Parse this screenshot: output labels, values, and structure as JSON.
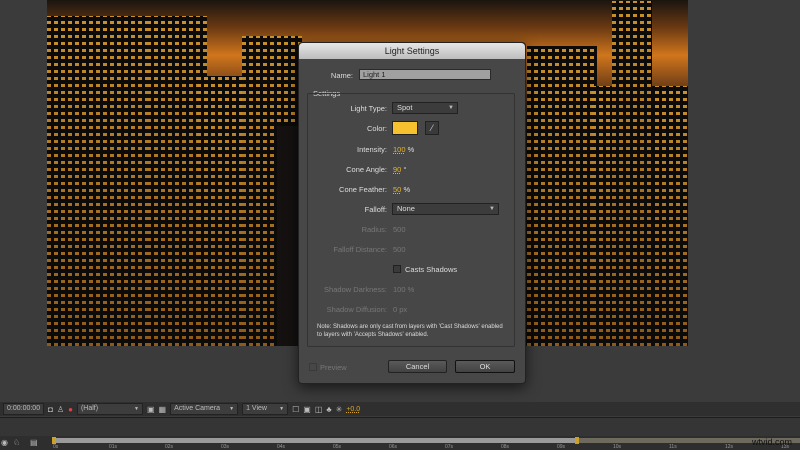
{
  "dialog": {
    "title": "Light Settings",
    "name_label": "Name:",
    "name_value": "Light 1",
    "group_label": "Settings",
    "light_type_label": "Light Type:",
    "light_type_value": "Spot",
    "color_label": "Color:",
    "color_value": "#f7c02e",
    "intensity_label": "Intensity:",
    "intensity_value": "100",
    "intensity_unit": "%",
    "cone_angle_label": "Cone Angle:",
    "cone_angle_value": "90",
    "cone_angle_unit": "°",
    "cone_feather_label": "Cone Feather:",
    "cone_feather_value": "50",
    "cone_feather_unit": "%",
    "falloff_label": "Falloff:",
    "falloff_value": "None",
    "radius_label": "Radius:",
    "radius_value": "500",
    "falloff_distance_label": "Falloff Distance:",
    "falloff_distance_value": "500",
    "casts_shadows_label": "Casts Shadows",
    "shadow_darkness_label": "Shadow Darkness:",
    "shadow_darkness_value": "100 %",
    "shadow_diffusion_label": "Shadow Diffusion:",
    "shadow_diffusion_value": "0 px",
    "note": "Note: Shadows are only cast from layers with 'Cast Shadows' enabled to layers with 'Accepts Shadows' enabled.",
    "preview_label": "Preview",
    "cancel_label": "Cancel",
    "ok_label": "OK"
  },
  "toolbar": {
    "timecode": "0:00:00:00",
    "resolution": "(Half)",
    "camera": "Active Camera",
    "views": "1 View",
    "exposure": "+0.0"
  },
  "timeline": {
    "ticks": [
      "0s",
      "01s",
      "02s",
      "03s",
      "04s",
      "05s",
      "06s",
      "07s",
      "08s",
      "09s",
      "10s",
      "11s",
      "12s",
      "13s"
    ]
  },
  "watermark": "wtvid.com"
}
